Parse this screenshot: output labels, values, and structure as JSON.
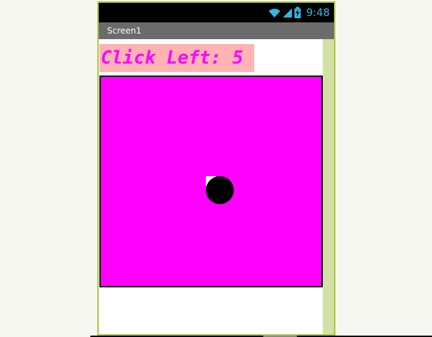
{
  "status_bar": {
    "time": "9:48",
    "icons": [
      "wifi-icon",
      "signal-icon",
      "battery-charging-icon"
    ],
    "accent_color": "#33b5e5"
  },
  "title_bar": {
    "title": "Screen1"
  },
  "label": {
    "text": "Click Left: 5"
  },
  "canvas": {
    "background_color": "#ff00ff"
  },
  "colors": {
    "phone_border": "#a6c83a",
    "label_background": "#ffb3b3",
    "label_text": "#ff00ff",
    "ball": "#000000",
    "right_strip": "#d5e0a7"
  }
}
